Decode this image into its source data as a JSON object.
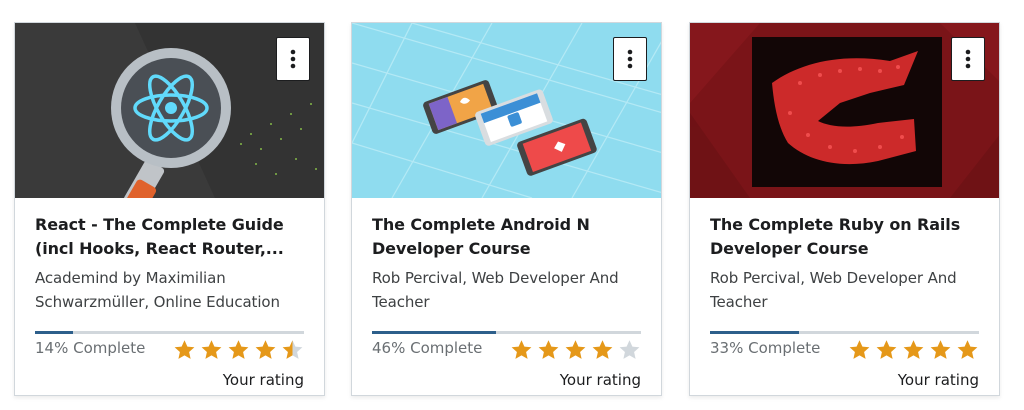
{
  "courses": [
    {
      "title": "React - The Complete Guide (incl Hooks, React Router,...",
      "instructor": "Academind by Maximilian Schwarzmüller, Online Education",
      "progress_percent": 14,
      "progress_text": "14% Complete",
      "rating": 4.5,
      "rating_label": "Your rating",
      "thumbnail_icon": "react-magnifier-icon",
      "menu_icon": "more-vertical-icon"
    },
    {
      "title": "The Complete Android N Developer Course",
      "instructor": "Rob Percival, Web Developer And Teacher",
      "progress_percent": 46,
      "progress_text": "46% Complete",
      "rating": 4,
      "rating_label": "Your rating",
      "thumbnail_icon": "android-phones-icon",
      "menu_icon": "more-vertical-icon"
    },
    {
      "title": "The Complete Ruby on Rails Developer Course",
      "instructor": "Rob Percival, Web Developer And Teacher",
      "progress_percent": 33,
      "progress_text": "33% Complete",
      "rating": 5,
      "rating_label": "Your rating",
      "thumbnail_icon": "ruby-rails-icon",
      "menu_icon": "more-vertical-icon"
    }
  ],
  "colors": {
    "star_filled": "#e59819",
    "star_empty": "#d1d7dc",
    "progress": "#2d5f8b"
  }
}
